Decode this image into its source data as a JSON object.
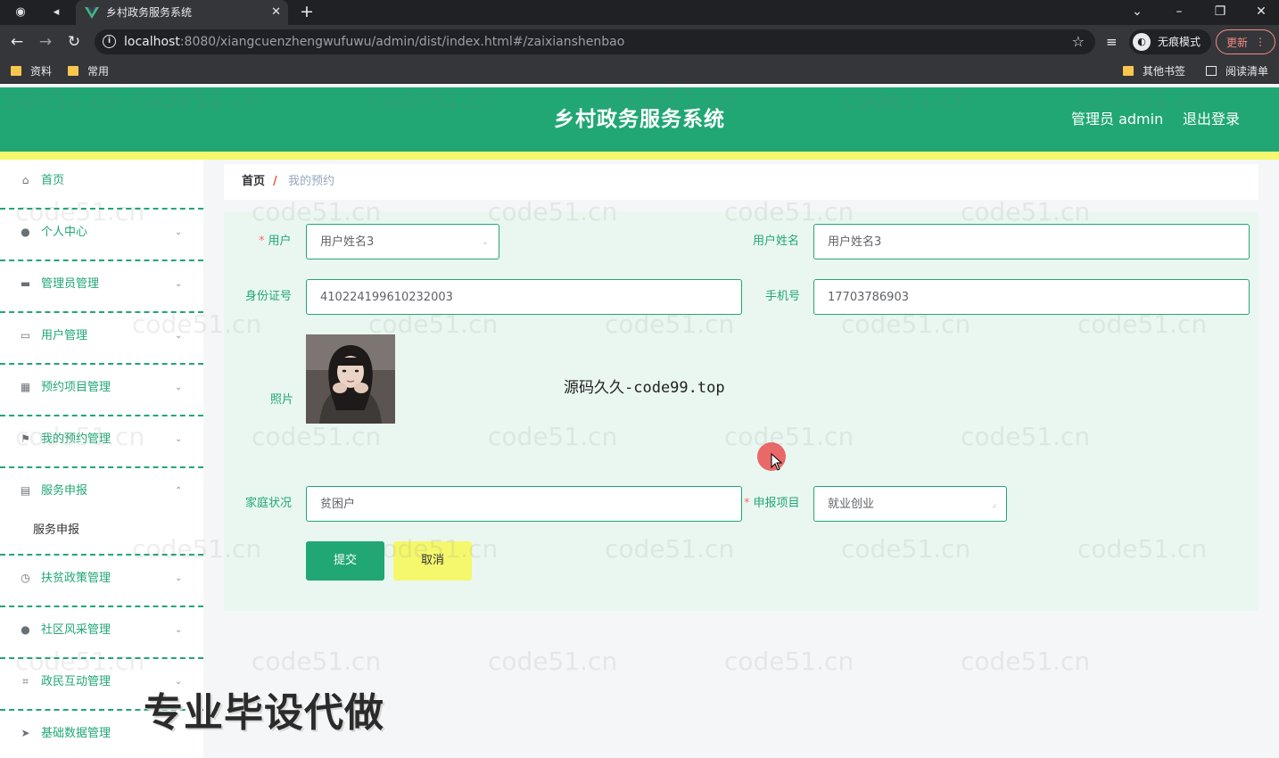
{
  "browser": {
    "tab_title": "乡村政务服务系统",
    "url_host": "localhost",
    "url_rest": ":8080/xiangcuenzhengwufuwu/admin/dist/index.html#/zaixianshenbao",
    "incognito_label": "无痕模式",
    "update_label": "更新",
    "bookmarks": {
      "left": [
        "资料",
        "常用"
      ],
      "other": "其他书签",
      "reading_list": "阅读清单"
    }
  },
  "header": {
    "title": "乡村政务服务系统",
    "user": "管理员 admin",
    "logout": "退出登录"
  },
  "sidebar": {
    "items": [
      {
        "label": "首页",
        "icon": "home-icon"
      },
      {
        "label": "个人中心",
        "icon": "user-icon"
      },
      {
        "label": "管理员管理",
        "icon": "briefcase-icon"
      },
      {
        "label": "用户管理",
        "icon": "chat-icon"
      },
      {
        "label": "预约项目管理",
        "icon": "grid-icon"
      },
      {
        "label": "我的预约管理",
        "icon": "flag-icon"
      },
      {
        "label": "服务申报",
        "icon": "message-icon"
      },
      {
        "label": "扶贫政策管理",
        "icon": "clock-icon"
      },
      {
        "label": "社区风采管理",
        "icon": "user-icon"
      },
      {
        "label": "政民互动管理",
        "icon": "crop-icon"
      },
      {
        "label": "基础数据管理",
        "icon": "send-icon"
      }
    ],
    "submenu": {
      "label": "服务申报"
    }
  },
  "breadcrumb": {
    "home": "首页",
    "separator": "/",
    "current": "我的预约"
  },
  "form": {
    "user_label": "用户",
    "user_value": "用户姓名3",
    "username_label": "用户姓名",
    "username_value": "用户姓名3",
    "idcard_label": "身份证号",
    "idcard_value": "410224199610232003",
    "phone_label": "手机号",
    "phone_value": "17703786903",
    "photo_label": "照片",
    "family_label": "家庭状况",
    "family_value": "贫困户",
    "project_label": "申报项目",
    "project_value": "就业创业",
    "submit": "提交",
    "cancel": "取消"
  },
  "overlays": {
    "watermark": "code51.cn",
    "source_note": "源码久久-code99.top",
    "promo": "专业毕设代做"
  },
  "colors": {
    "primary": "#21a774",
    "accent": "#f5f86c",
    "required": "#f56c6c"
  }
}
